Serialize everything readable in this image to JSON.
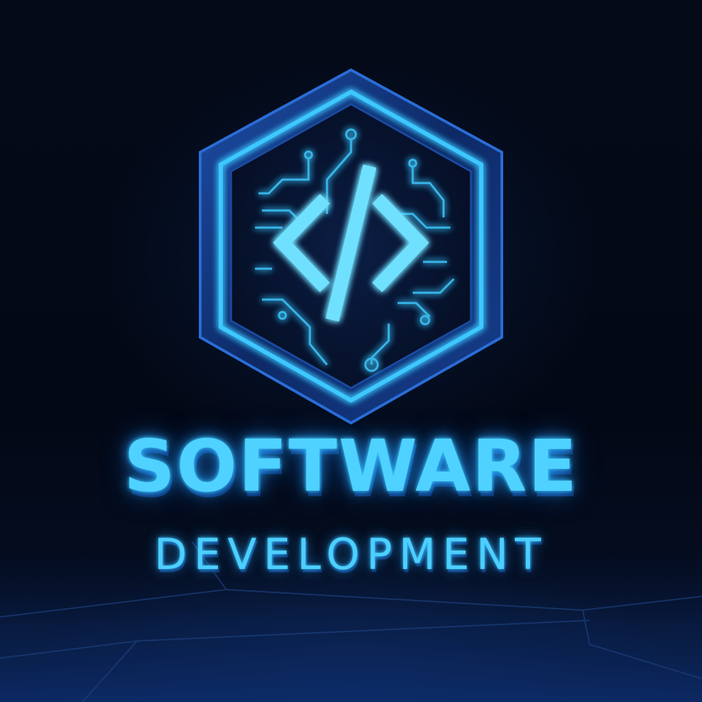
{
  "logo": {
    "title": "SOFTWARE",
    "subtitle": "DEVELOPMENT",
    "emblem_icon": "code-tag-icon",
    "colors": {
      "background": "#02060f",
      "neon": "#4fd2ff",
      "frame": "#123a8a"
    }
  }
}
